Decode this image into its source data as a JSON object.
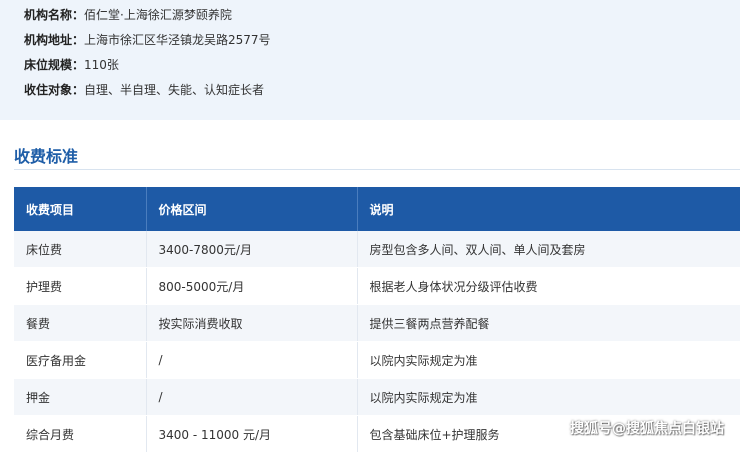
{
  "info": [
    {
      "key": "机构名称：",
      "value": "佰仁堂·上海徐汇源梦颐养院"
    },
    {
      "key": "机构地址：",
      "value": "上海市徐汇区华泾镇龙吴路2577号"
    },
    {
      "key": "床位规模：",
      "value": "110张"
    },
    {
      "key": "收住对象：",
      "value": "自理、半自理、失能、认知症长者"
    }
  ],
  "section_title": "收费标准",
  "table": {
    "headers": [
      "收费项目",
      "价格区间",
      "说明"
    ],
    "rows": [
      [
        "床位费",
        "3400-7800元/月",
        "房型包含多人间、双人间、单人间及套房"
      ],
      [
        "护理费",
        "800-5000元/月",
        "根据老人身体状况分级评估收费"
      ],
      [
        "餐费",
        "按实际消费收取",
        "提供三餐两点营养配餐"
      ],
      [
        "医疗备用金",
        "/",
        "以院内实际规定为准"
      ],
      [
        "押金",
        "/",
        "以院内实际规定为准"
      ],
      [
        "综合月费",
        "3400 - 11000 元/月",
        "包含基础床位+护理服务"
      ]
    ]
  },
  "watermark": "搜狐号@搜狐焦点白银站",
  "colors": {
    "panel_bg": "#eef4fb",
    "header_bg": "#1e5aa6",
    "title_color": "#1f5ea8",
    "stripe_bg": "#f3f6fa"
  }
}
